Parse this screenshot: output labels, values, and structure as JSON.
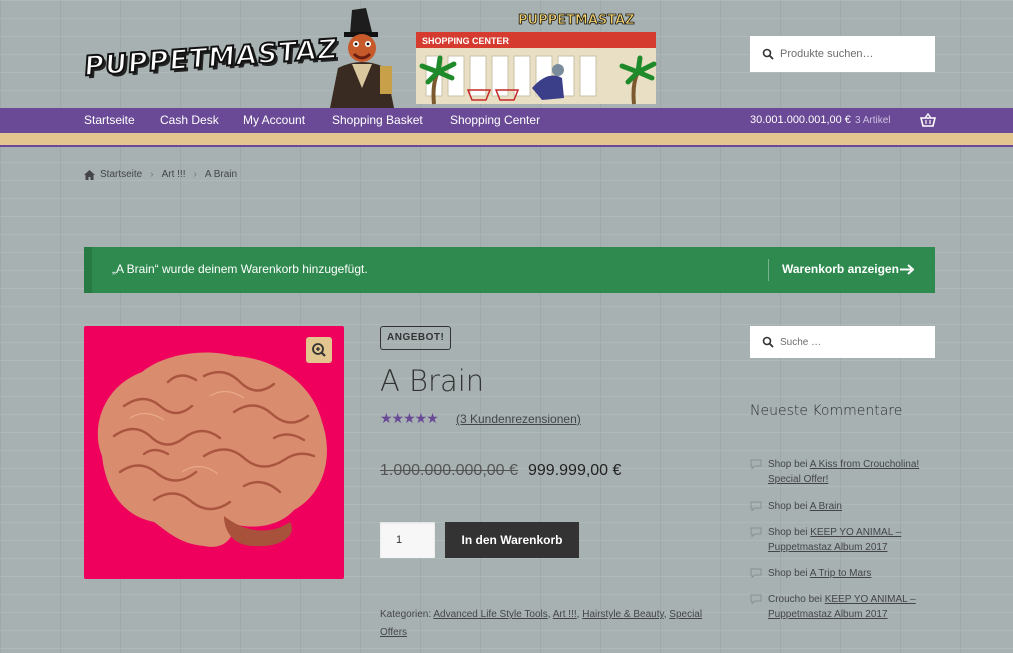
{
  "header": {
    "logo_text": "PUPPETMASTAZ",
    "mall_sign": "SHOPPING CENTER",
    "mall_logo": "PUPPETMASTAZ",
    "search_placeholder": "Produkte suchen…"
  },
  "nav": {
    "items": [
      {
        "label": "Startseite"
      },
      {
        "label": "Cash Desk"
      },
      {
        "label": "My Account"
      },
      {
        "label": "Shopping Basket"
      },
      {
        "label": "Shopping Center"
      }
    ],
    "cart_total": "30.001.000.001,00 €",
    "cart_count": "3 Artikel",
    "cart_icon": "basket-icon"
  },
  "breadcrumb": {
    "items": [
      "Startseite",
      "Art !!!",
      "A Brain"
    ]
  },
  "notice": {
    "message": "„A Brain“ wurde deinem Warenkorb hinzugefügt.",
    "link_label": "Warenkorb anzeigen"
  },
  "product": {
    "badge": "ANGEBOT!",
    "title": "A Brain",
    "rating_stars": "★★★★★",
    "rating_value": 5,
    "reviews_link": "(3 Kundenrezensionen)",
    "price_old": "1.000.000.000,00 €",
    "price_new": "999.999,00 €",
    "quantity": "1",
    "add_to_cart_label": "In den Warenkorb",
    "categories_label": "Kategorien:",
    "categories": [
      "Advanced Life Style Tools",
      "Art !!!",
      "Hairstyle & Beauty",
      "Special Offers"
    ],
    "image_bg": "#ef005c"
  },
  "sidebar": {
    "search_placeholder": "Suche …",
    "widget_title": "Neueste Kommentare",
    "comments": [
      {
        "author": "Shop",
        "joiner": " bei ",
        "post": "A Kiss from Croucholina! Special Offer!"
      },
      {
        "author": "Shop",
        "joiner": " bei ",
        "post": "A Brain"
      },
      {
        "author": "Shop",
        "joiner": " bei ",
        "post": "KEEP YO ANIMAL – Puppetmastaz Album 2017"
      },
      {
        "author": "Shop",
        "joiner": " bei ",
        "post": "A Trip to Mars"
      },
      {
        "author": "Croucho",
        "joiner": " bei ",
        "post": "KEEP YO ANIMAL – Puppetmastaz Album 2017"
      }
    ]
  },
  "colors": {
    "nav_bg": "#6a4a96",
    "stripe": "#e2c58f",
    "notice_bg": "#2e8a4f",
    "button_bg": "#333333",
    "star": "#6a4a96"
  }
}
